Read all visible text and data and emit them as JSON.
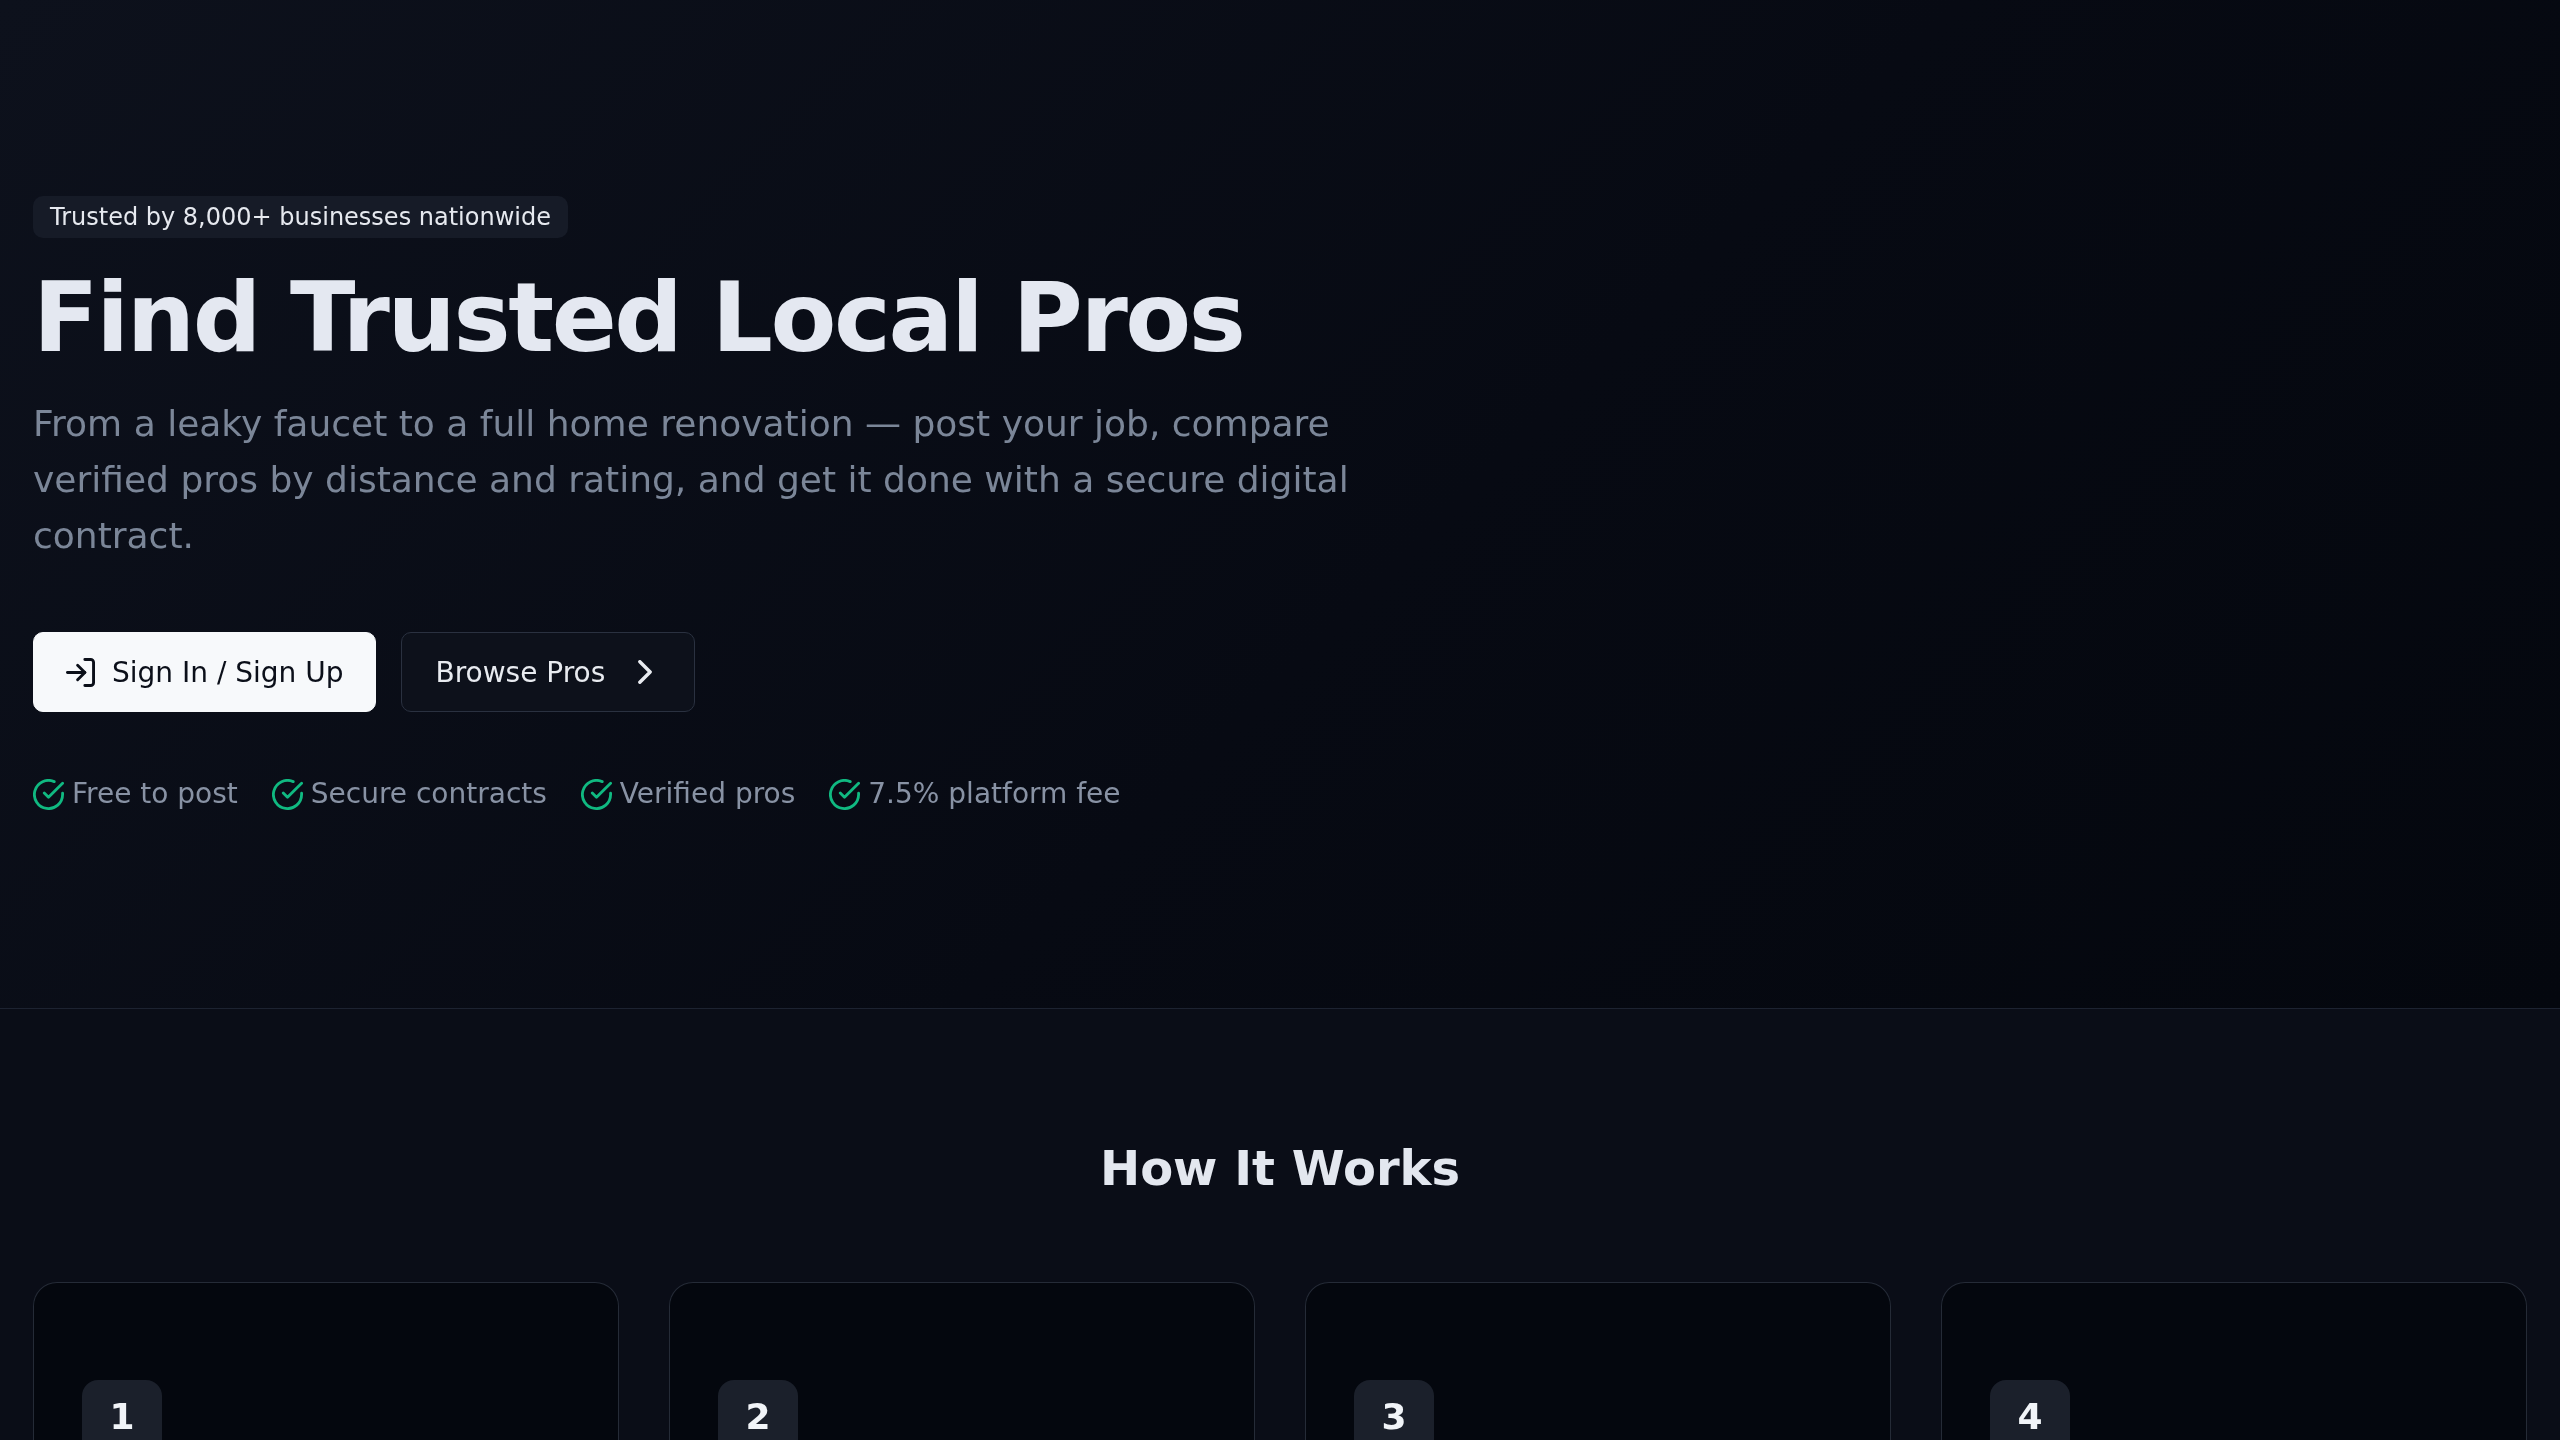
{
  "hero": {
    "badge": "Trusted by 8,000+ businesses nationwide",
    "title": "Find Trusted Local Pros",
    "description": "From a leaky faucet to a full home renovation — post your job, compare verified pros by distance and rating, and get it done with a secure digital contract.",
    "buttons": [
      {
        "label": "Sign In / Sign Up",
        "kind": "primary"
      },
      {
        "label": "Browse Pros",
        "kind": "secondary"
      }
    ],
    "features": [
      "Free to post",
      "Secure contracts",
      "Verified pros",
      "7.5% platform fee"
    ]
  },
  "how_it_works": {
    "title": "How It Works",
    "steps": [
      "1",
      "2",
      "3",
      "4"
    ]
  }
}
